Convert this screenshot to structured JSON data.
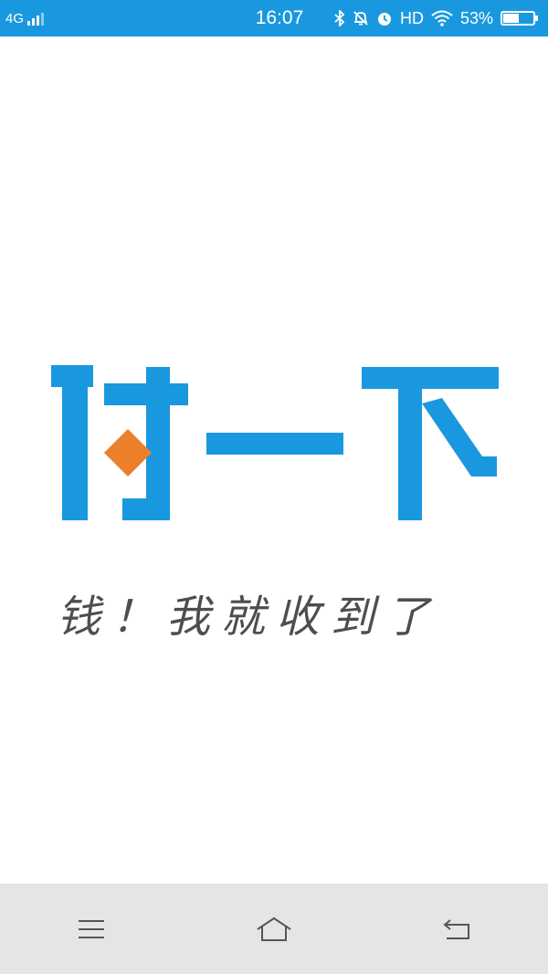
{
  "status_bar": {
    "network": "4G",
    "time": "16:07",
    "hd": "HD",
    "battery": "53%",
    "battery_level": 0.53,
    "icons": [
      "signal-icon",
      "bluetooth-icon",
      "mute-icon",
      "alarm-icon",
      "wifi-icon",
      "battery-icon"
    ]
  },
  "splash": {
    "logo_text": "付一下",
    "slogan": "钱！我就收到了",
    "colors": {
      "logo": "#1a98df",
      "diamond": "#ec7f2c",
      "slogan": "#4e4e4e"
    }
  },
  "nav_bar": {
    "icons": [
      "menu-icon",
      "home-icon",
      "back-icon"
    ]
  }
}
